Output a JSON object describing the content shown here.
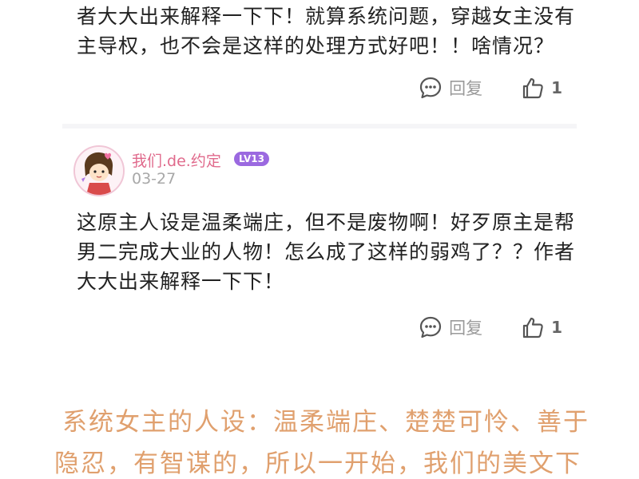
{
  "comment1": {
    "text_line1": "者大大出来解释一下下！就算系统问题，穿越女主没有",
    "text_line2": "主导权，也不会是这样的处理方式好吧！！啥情况？",
    "reply_label": "回复",
    "like_count": "1"
  },
  "comment2": {
    "username": "我们.de.约定",
    "level": "LV13",
    "date": "03-27",
    "text_line1": "这原主人设是温柔端庄，但不是废物啊！好歹原主是帮",
    "text_line2": "男二完成大业的人物！怎么成了这样的弱鸡了？？作者",
    "text_line3": "大大出来解释一下下！",
    "reply_label": "回复",
    "like_count": "1"
  },
  "caption": {
    "line1": "系统女主的人设：温柔端庄、楚楚可怜、善于",
    "line2": "隐忍，有智谋的，所以一开始，我们的美文下"
  },
  "colors": {
    "username": "#e06a8c",
    "level_badge": "#9b69e0",
    "caption": "#e0a06e"
  }
}
